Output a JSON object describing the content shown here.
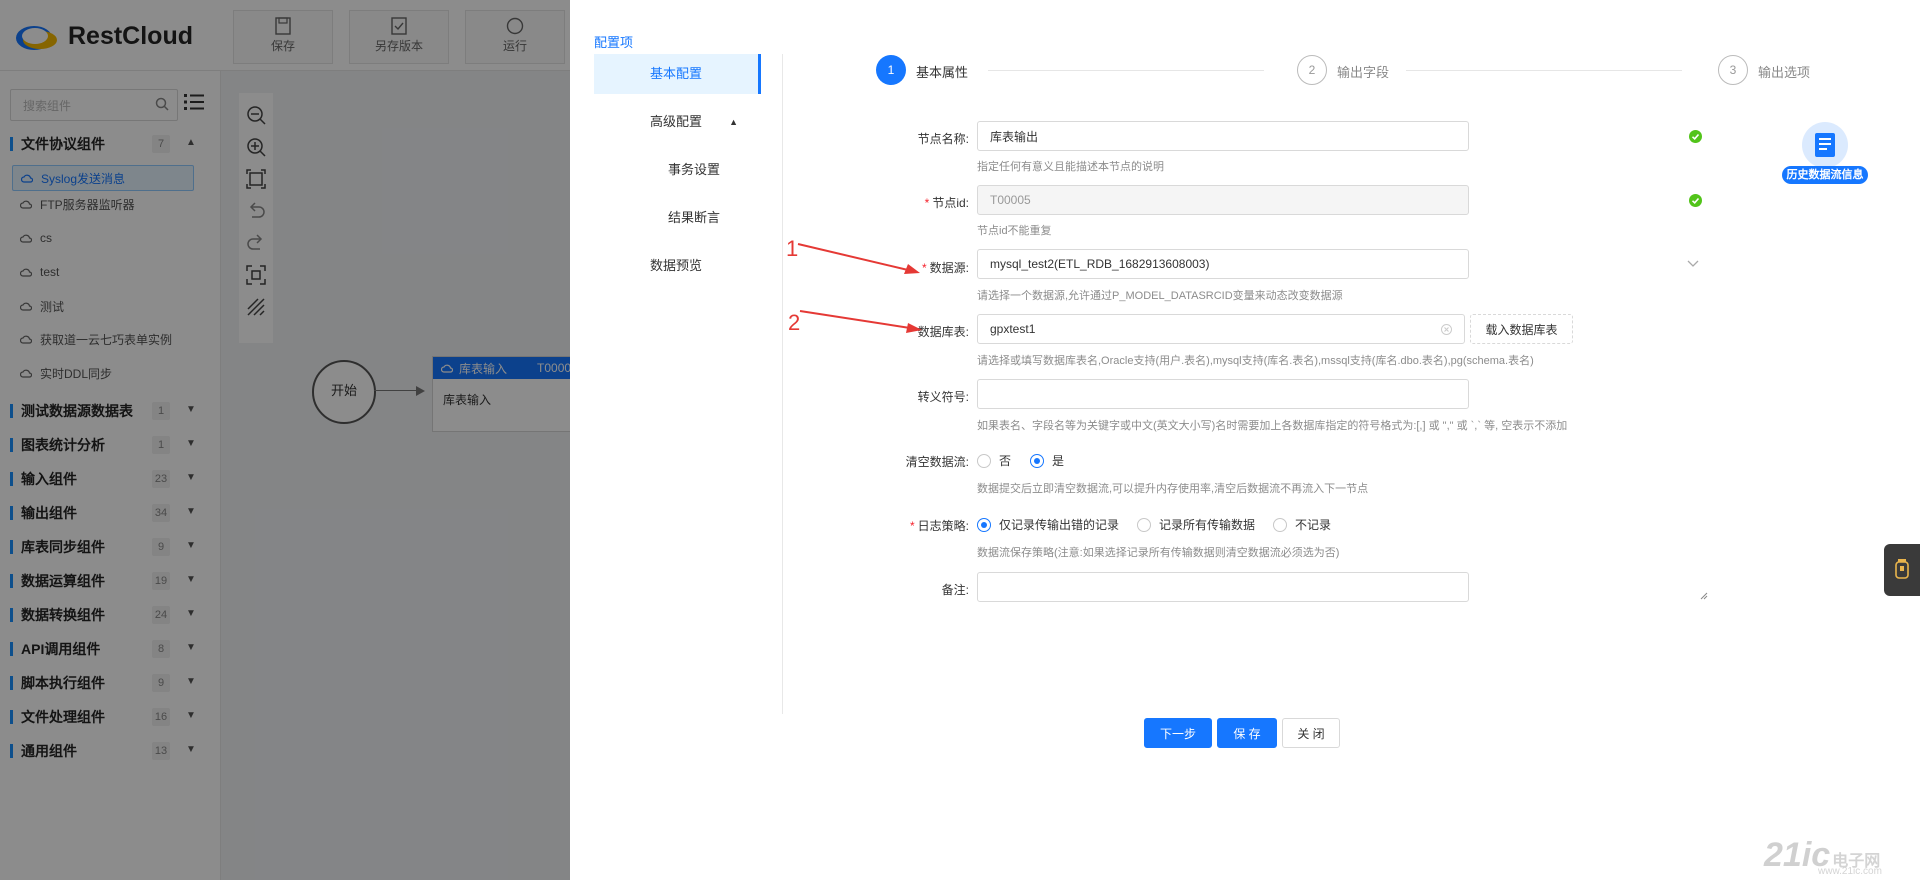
{
  "app": {
    "brand": "RestCloud",
    "toolbar": {
      "save": "保存",
      "save_as": "另存版本",
      "run": "运行"
    },
    "search": {
      "placeholder": "搜索组件"
    },
    "groups": [
      {
        "label": "文件协议组件",
        "count": "7",
        "expanded": true
      },
      {
        "label": "测试数据源数据表",
        "count": "1"
      },
      {
        "label": "图表统计分析",
        "count": "1"
      },
      {
        "label": "输入组件",
        "count": "23"
      },
      {
        "label": "输出组件",
        "count": "34"
      },
      {
        "label": "库表同步组件",
        "count": "9"
      },
      {
        "label": "数据运算组件",
        "count": "19"
      },
      {
        "label": "数据转换组件",
        "count": "24"
      },
      {
        "label": "API调用组件",
        "count": "8"
      },
      {
        "label": "脚本执行组件",
        "count": "9"
      },
      {
        "label": "文件处理组件",
        "count": "16"
      },
      {
        "label": "通用组件",
        "count": "13"
      }
    ],
    "leaves": [
      "Syslog发送消息",
      "FTP服务器监听器",
      "cs",
      "test",
      "测试",
      "获取道一云七巧表单实例",
      "实时DDL同步"
    ],
    "canvas": {
      "start_node": "开始",
      "task_node_title": "库表输入",
      "task_node_id": "T0000",
      "task_node_body": "库表输入"
    }
  },
  "drawer": {
    "title": "配置项",
    "nav": {
      "basic": "基本配置",
      "advanced": "高级配置",
      "transaction": "事务设置",
      "assertion": "结果断言",
      "preview": "数据预览"
    },
    "steps": [
      {
        "num": "1",
        "label": "基本属性"
      },
      {
        "num": "2",
        "label": "输出字段"
      },
      {
        "num": "3",
        "label": "输出选项"
      }
    ],
    "form": {
      "node_name": {
        "label": "节点名称:",
        "value": "库表输出",
        "help": "指定任何有意义且能描述本节点的说明"
      },
      "node_id": {
        "label": "节点id:",
        "value": "T00005",
        "help": "节点id不能重复"
      },
      "datasource": {
        "label": "数据源:",
        "value": "mysql_test2(ETL_RDB_1682913608003)",
        "help": "请选择一个数据源,允许通过P_MODEL_DATASRCID变量来动态改变数据源"
      },
      "table": {
        "label": "数据库表:",
        "value": "gpxtest1",
        "load_button": "载入数据库表",
        "help": "请选择或填写数据库表名,Oracle支持(用户.表名),mysql支持(库名.表名),mssql支持(库名.dbo.表名),pg(schema.表名)"
      },
      "escape": {
        "label": "转义符号:",
        "value": "",
        "help": "如果表名、字段名等为关键字或中文(英文大小写)名时需要加上各数据库指定的符号格式为:[,] 或 \",\" 或 `,` 等, 空表示不添加"
      },
      "clear_stream": {
        "label": "清空数据流:",
        "options": [
          "否",
          "是"
        ],
        "selected": "是",
        "help": "数据提交后立即清空数据流,可以提升内存使用率,清空后数据流不再流入下一节点"
      },
      "log_policy": {
        "label": "日志策略:",
        "options": [
          "仅记录传输出错的记录",
          "记录所有传输数据",
          "不记录"
        ],
        "selected": "仅记录传输出错的记录",
        "help": "数据流保存策略(注意:如果选择记录所有传输数据则清空数据流必须选为否)"
      },
      "remark": {
        "label": "备注:",
        "value": ""
      }
    },
    "buttons": {
      "next": "下一步",
      "save": "保 存",
      "close": "关 闭"
    },
    "history_widget": "历史数据流信息",
    "annotations": [
      "1",
      "2"
    ],
    "watermark": {
      "main": "21ic",
      "sub": "电子网",
      "url": "www.21ic.com"
    }
  },
  "colors": {
    "primary": "#1677ff",
    "success": "#52c41a",
    "annotation": "#e53935"
  }
}
